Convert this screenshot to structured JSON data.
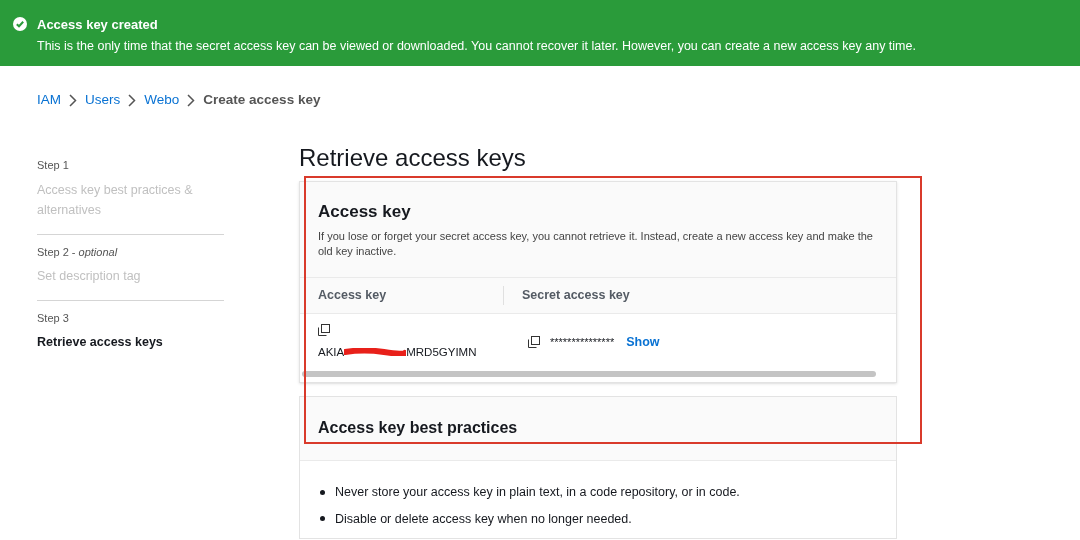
{
  "banner": {
    "title": "Access key created",
    "message": "This is the only time that the secret access key can be viewed or downloaded. You cannot recover it later. However, you can create a new access key any time."
  },
  "breadcrumbs": [
    {
      "label": "IAM",
      "kind": "link"
    },
    {
      "label": "Users",
      "kind": "link"
    },
    {
      "label": "Webo",
      "kind": "link"
    },
    {
      "label": "Create access key",
      "kind": "current"
    }
  ],
  "steps": [
    {
      "step": "Step 1",
      "title": "Access key best practices & alternatives",
      "selected": false
    },
    {
      "step": "Step 2 - *optional*",
      "title": "Set description tag",
      "selected": false
    },
    {
      "step": "Step 3",
      "title": "Retrieve access keys",
      "selected": true
    }
  ],
  "page_title": "Retrieve access keys",
  "access_key_card": {
    "title": "Access key",
    "description": "If you lose or forget your secret access key, you cannot retrieve it. Instead, create a new access key and make the old key inactive.",
    "columns": [
      "Access key",
      "Secret access key"
    ],
    "access_key_start": "AKIA",
    "access_key_end": "MRD5GYIMN",
    "secret_masked": "***************",
    "show_link": "Show"
  },
  "best_practices": {
    "title": "Access key best practices",
    "items": [
      "Never store your access key in plain text, in a code repository, or in code.",
      "Disable or delete access key when no longer needed."
    ]
  }
}
